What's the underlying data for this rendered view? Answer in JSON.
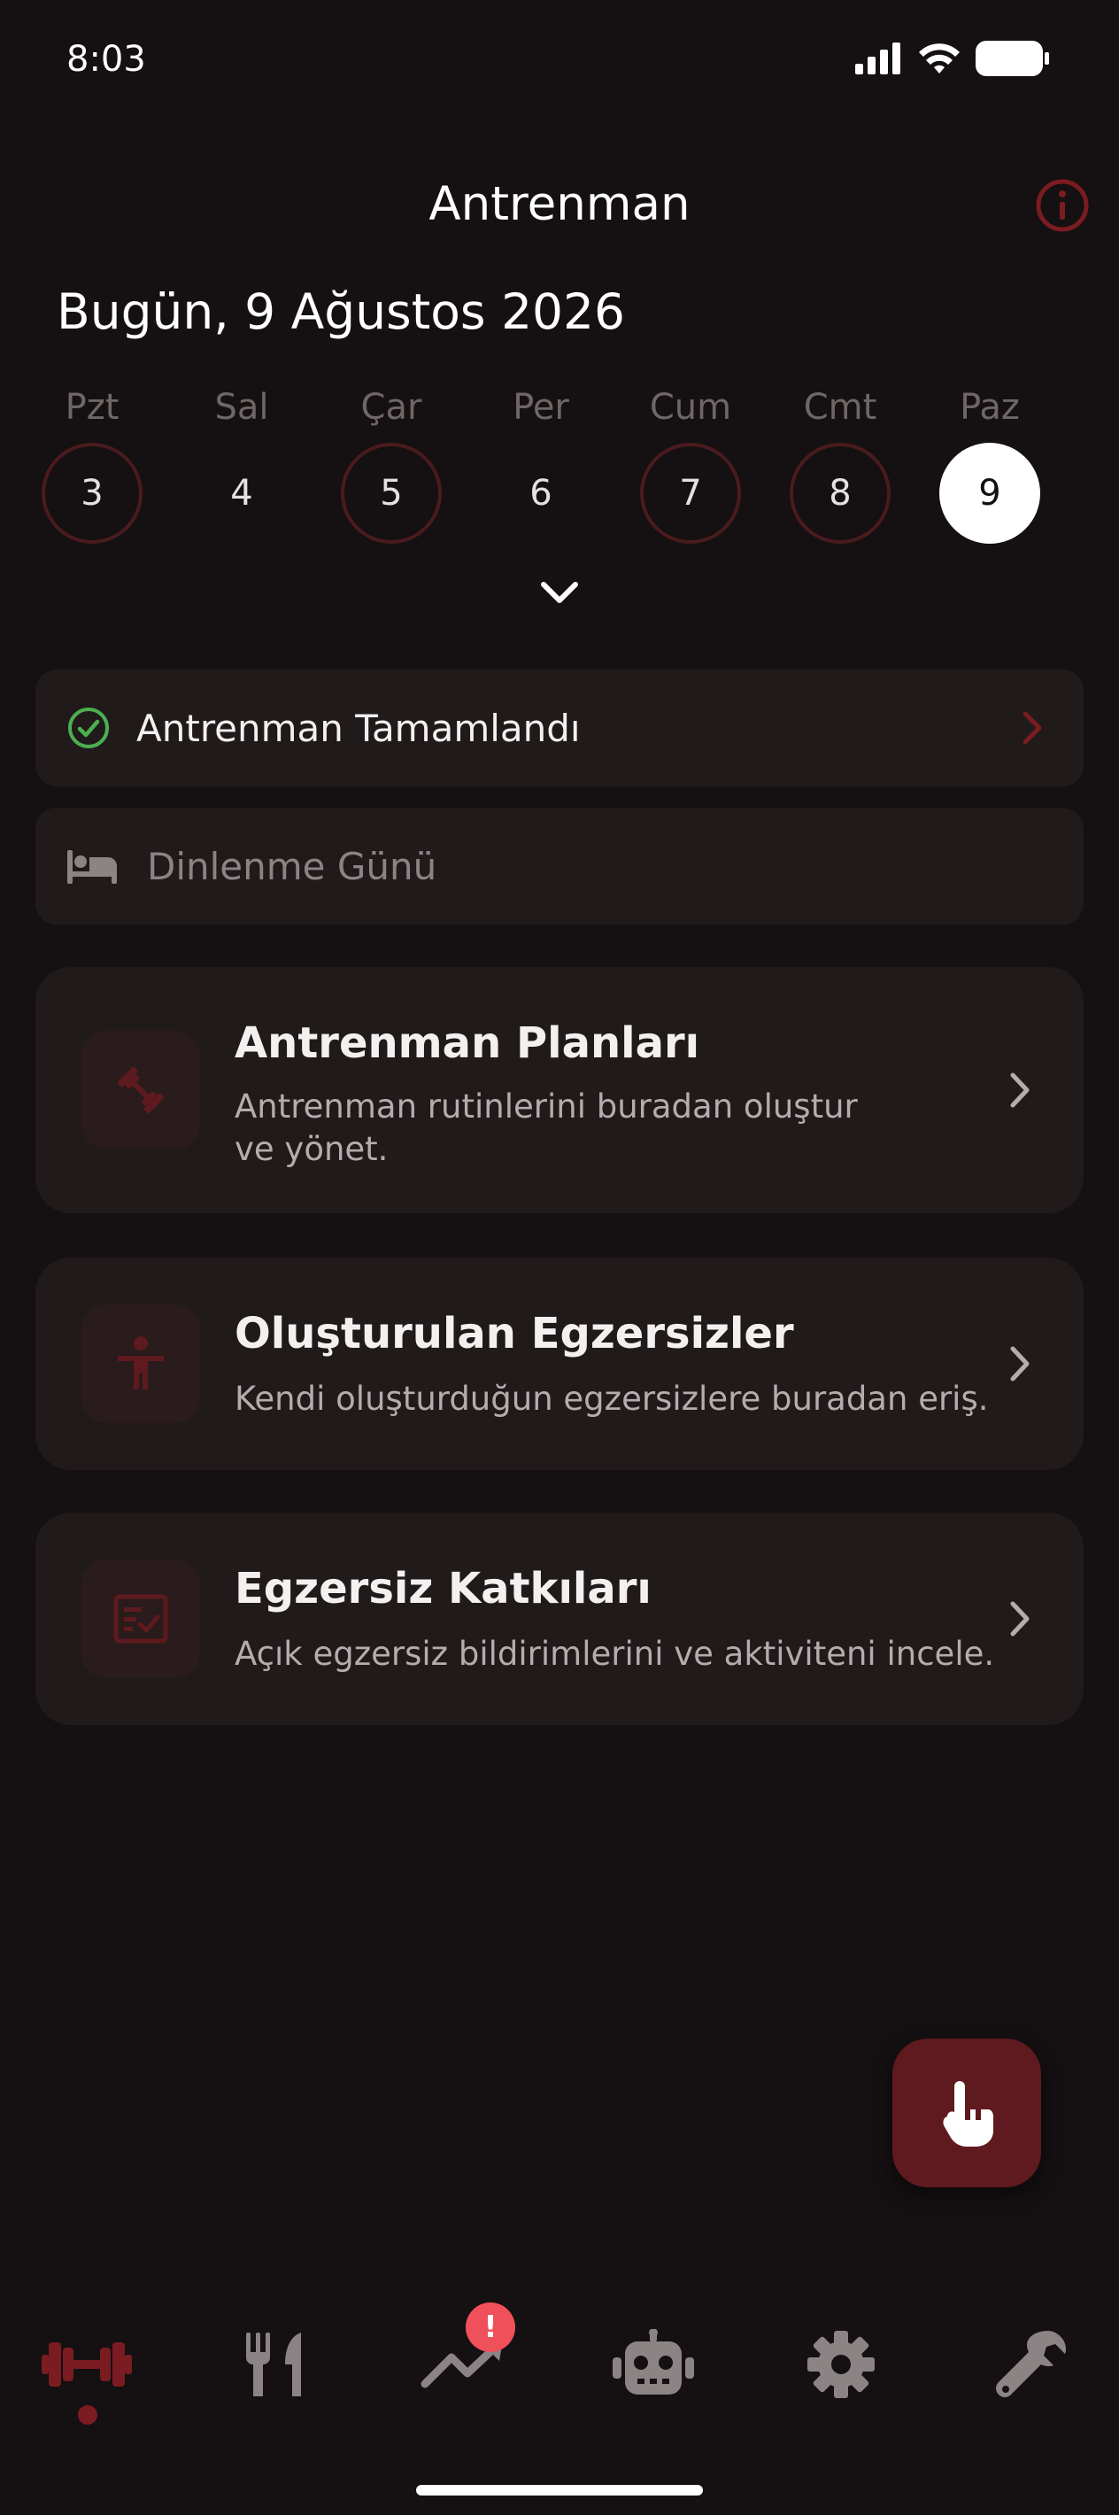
{
  "status_bar": {
    "time": "8:03"
  },
  "header": {
    "title": "Antrenman"
  },
  "date_title": "Bugün, 9 Ağustos 2026",
  "week": [
    {
      "name": "Pzt",
      "num": "3",
      "style": "ring"
    },
    {
      "name": "Sal",
      "num": "4",
      "style": "plain"
    },
    {
      "name": "Çar",
      "num": "5",
      "style": "ring"
    },
    {
      "name": "Per",
      "num": "6",
      "style": "plain"
    },
    {
      "name": "Cum",
      "num": "7",
      "style": "ring"
    },
    {
      "name": "Cmt",
      "num": "8",
      "style": "ring"
    },
    {
      "name": "Paz",
      "num": "9",
      "style": "selected"
    }
  ],
  "status_rows": {
    "completed": "Antrenman Tamamlandı",
    "rest": "Dinlenme Günü"
  },
  "cards": [
    {
      "title": "Antrenman Planları",
      "desc": "Antrenman rutinlerini buradan oluştur ve yönet.",
      "icon": "dumbbell-icon"
    },
    {
      "title": "Oluşturulan Egzersizler",
      "desc": "Kendi oluşturduğun egzersizlere buradan eriş.",
      "icon": "person-icon"
    },
    {
      "title": "Egzersiz Katkıları",
      "desc": "Açık egzersiz bildirimlerini ve aktiviteni incele.",
      "icon": "form-check-icon"
    }
  ],
  "nav": {
    "items": [
      "dumbbell-icon",
      "utensils-icon",
      "trending-up-icon",
      "robot-icon",
      "gear-icon",
      "wrench-icon"
    ],
    "badge": "!"
  },
  "colors": {
    "background": "#151011",
    "surface": "#211a1b",
    "accent": "#7a1c21",
    "success": "#4caf50",
    "badge": "#f0505a"
  }
}
